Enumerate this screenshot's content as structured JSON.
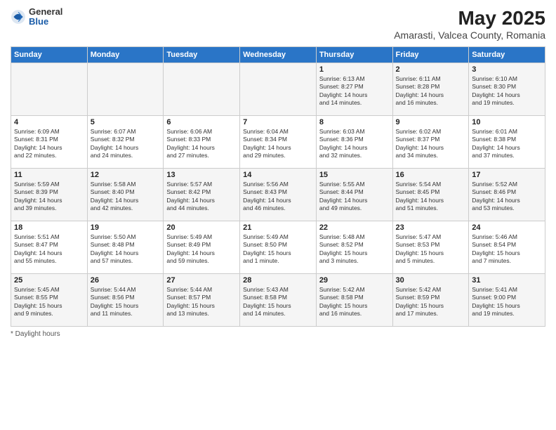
{
  "header": {
    "logo_general": "General",
    "logo_blue": "Blue",
    "month_title": "May 2025",
    "location": "Amarasti, Valcea County, Romania"
  },
  "weekdays": [
    "Sunday",
    "Monday",
    "Tuesday",
    "Wednesday",
    "Thursday",
    "Friday",
    "Saturday"
  ],
  "footer": {
    "note": "Daylight hours"
  },
  "weeks": [
    [
      {
        "day": "",
        "info": ""
      },
      {
        "day": "",
        "info": ""
      },
      {
        "day": "",
        "info": ""
      },
      {
        "day": "",
        "info": ""
      },
      {
        "day": "1",
        "info": "Sunrise: 6:13 AM\nSunset: 8:27 PM\nDaylight: 14 hours\nand 14 minutes."
      },
      {
        "day": "2",
        "info": "Sunrise: 6:11 AM\nSunset: 8:28 PM\nDaylight: 14 hours\nand 16 minutes."
      },
      {
        "day": "3",
        "info": "Sunrise: 6:10 AM\nSunset: 8:30 PM\nDaylight: 14 hours\nand 19 minutes."
      }
    ],
    [
      {
        "day": "4",
        "info": "Sunrise: 6:09 AM\nSunset: 8:31 PM\nDaylight: 14 hours\nand 22 minutes."
      },
      {
        "day": "5",
        "info": "Sunrise: 6:07 AM\nSunset: 8:32 PM\nDaylight: 14 hours\nand 24 minutes."
      },
      {
        "day": "6",
        "info": "Sunrise: 6:06 AM\nSunset: 8:33 PM\nDaylight: 14 hours\nand 27 minutes."
      },
      {
        "day": "7",
        "info": "Sunrise: 6:04 AM\nSunset: 8:34 PM\nDaylight: 14 hours\nand 29 minutes."
      },
      {
        "day": "8",
        "info": "Sunrise: 6:03 AM\nSunset: 8:36 PM\nDaylight: 14 hours\nand 32 minutes."
      },
      {
        "day": "9",
        "info": "Sunrise: 6:02 AM\nSunset: 8:37 PM\nDaylight: 14 hours\nand 34 minutes."
      },
      {
        "day": "10",
        "info": "Sunrise: 6:01 AM\nSunset: 8:38 PM\nDaylight: 14 hours\nand 37 minutes."
      }
    ],
    [
      {
        "day": "11",
        "info": "Sunrise: 5:59 AM\nSunset: 8:39 PM\nDaylight: 14 hours\nand 39 minutes."
      },
      {
        "day": "12",
        "info": "Sunrise: 5:58 AM\nSunset: 8:40 PM\nDaylight: 14 hours\nand 42 minutes."
      },
      {
        "day": "13",
        "info": "Sunrise: 5:57 AM\nSunset: 8:42 PM\nDaylight: 14 hours\nand 44 minutes."
      },
      {
        "day": "14",
        "info": "Sunrise: 5:56 AM\nSunset: 8:43 PM\nDaylight: 14 hours\nand 46 minutes."
      },
      {
        "day": "15",
        "info": "Sunrise: 5:55 AM\nSunset: 8:44 PM\nDaylight: 14 hours\nand 49 minutes."
      },
      {
        "day": "16",
        "info": "Sunrise: 5:54 AM\nSunset: 8:45 PM\nDaylight: 14 hours\nand 51 minutes."
      },
      {
        "day": "17",
        "info": "Sunrise: 5:52 AM\nSunset: 8:46 PM\nDaylight: 14 hours\nand 53 minutes."
      }
    ],
    [
      {
        "day": "18",
        "info": "Sunrise: 5:51 AM\nSunset: 8:47 PM\nDaylight: 14 hours\nand 55 minutes."
      },
      {
        "day": "19",
        "info": "Sunrise: 5:50 AM\nSunset: 8:48 PM\nDaylight: 14 hours\nand 57 minutes."
      },
      {
        "day": "20",
        "info": "Sunrise: 5:49 AM\nSunset: 8:49 PM\nDaylight: 14 hours\nand 59 minutes."
      },
      {
        "day": "21",
        "info": "Sunrise: 5:49 AM\nSunset: 8:50 PM\nDaylight: 15 hours\nand 1 minute."
      },
      {
        "day": "22",
        "info": "Sunrise: 5:48 AM\nSunset: 8:52 PM\nDaylight: 15 hours\nand 3 minutes."
      },
      {
        "day": "23",
        "info": "Sunrise: 5:47 AM\nSunset: 8:53 PM\nDaylight: 15 hours\nand 5 minutes."
      },
      {
        "day": "24",
        "info": "Sunrise: 5:46 AM\nSunset: 8:54 PM\nDaylight: 15 hours\nand 7 minutes."
      }
    ],
    [
      {
        "day": "25",
        "info": "Sunrise: 5:45 AM\nSunset: 8:55 PM\nDaylight: 15 hours\nand 9 minutes."
      },
      {
        "day": "26",
        "info": "Sunrise: 5:44 AM\nSunset: 8:56 PM\nDaylight: 15 hours\nand 11 minutes."
      },
      {
        "day": "27",
        "info": "Sunrise: 5:44 AM\nSunset: 8:57 PM\nDaylight: 15 hours\nand 13 minutes."
      },
      {
        "day": "28",
        "info": "Sunrise: 5:43 AM\nSunset: 8:58 PM\nDaylight: 15 hours\nand 14 minutes."
      },
      {
        "day": "29",
        "info": "Sunrise: 5:42 AM\nSunset: 8:58 PM\nDaylight: 15 hours\nand 16 minutes."
      },
      {
        "day": "30",
        "info": "Sunrise: 5:42 AM\nSunset: 8:59 PM\nDaylight: 15 hours\nand 17 minutes."
      },
      {
        "day": "31",
        "info": "Sunrise: 5:41 AM\nSunset: 9:00 PM\nDaylight: 15 hours\nand 19 minutes."
      }
    ]
  ]
}
